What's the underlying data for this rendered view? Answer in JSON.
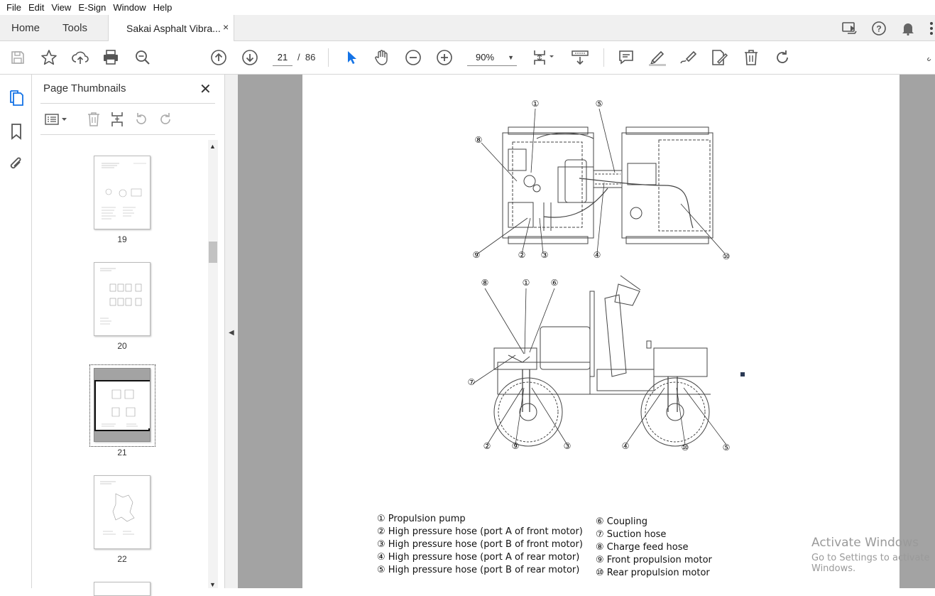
{
  "menu": [
    "File",
    "Edit",
    "View",
    "E-Sign",
    "Window",
    "Help"
  ],
  "tabs": {
    "home": "Home",
    "tools": "Tools",
    "document": "Sakai Asphalt Vibra...",
    "close": "×"
  },
  "toolbar": {
    "current_page": "21",
    "page_separator": "/",
    "total_pages": "86",
    "zoom": "90%"
  },
  "panel": {
    "title": "Page Thumbnails",
    "close": "✕",
    "thumbnails": [
      {
        "label": "19"
      },
      {
        "label": "20"
      },
      {
        "label": "21",
        "selected": true
      },
      {
        "label": "22"
      }
    ]
  },
  "figure": {
    "top_view_callouts": [
      "①",
      "⑤",
      "⑧",
      "⑨",
      "②",
      "③",
      "④",
      "⑩"
    ],
    "side_view_callouts": [
      "⑧",
      "①",
      "⑥",
      "⑦",
      "②",
      "⑨",
      "③",
      "④",
      "⑩",
      "⑤"
    ]
  },
  "legend": {
    "left": [
      "① Propulsion pump",
      "② High pressure hose (port A of front motor)",
      "③ High pressure hose (port B of front motor)",
      "④ High pressure hose (port A of rear motor)",
      "⑤ High pressure hose (port B of rear motor)"
    ],
    "right": [
      "⑥ Coupling",
      "⑦ Suction hose",
      "⑧ Charge feed hose",
      "⑨ Front propulsion motor",
      "⑩ Rear propulsion motor"
    ]
  },
  "watermark": {
    "line1": "Activate Windows",
    "line2": "Go to Settings to activate Windows."
  },
  "colors": {
    "accent": "#1473e6",
    "viewport_bg": "#a3a3a3",
    "chrome_bg": "#f0f0f0"
  }
}
